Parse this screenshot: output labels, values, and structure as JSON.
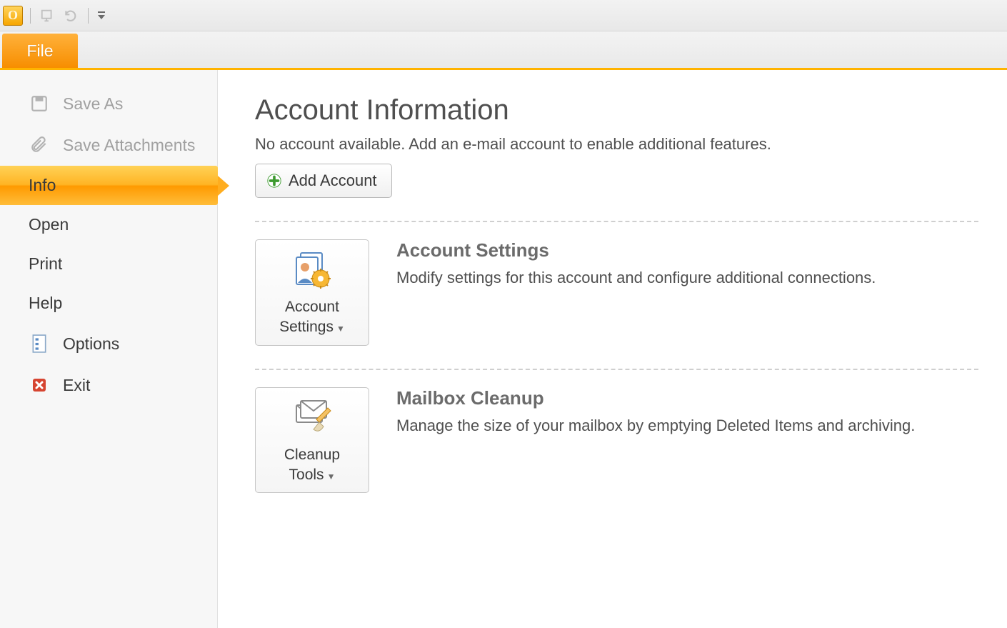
{
  "ribbon": {
    "file_tab": "File"
  },
  "sidebar": {
    "save_as": "Save As",
    "save_attachments": "Save Attachments",
    "info": "Info",
    "open": "Open",
    "print": "Print",
    "help": "Help",
    "options": "Options",
    "exit": "Exit"
  },
  "main": {
    "title": "Account Information",
    "no_account_msg": "No account available. Add an e-mail account to enable additional features.",
    "add_account_label": "Add Account",
    "account_settings": {
      "title": "Account Settings",
      "desc": "Modify settings for this account and configure additional connections.",
      "btn_line1": "Account",
      "btn_line2": "Settings"
    },
    "mailbox_cleanup": {
      "title": "Mailbox Cleanup",
      "desc": "Manage the size of your mailbox by emptying Deleted Items and archiving.",
      "btn_line1": "Cleanup",
      "btn_line2": "Tools"
    }
  }
}
